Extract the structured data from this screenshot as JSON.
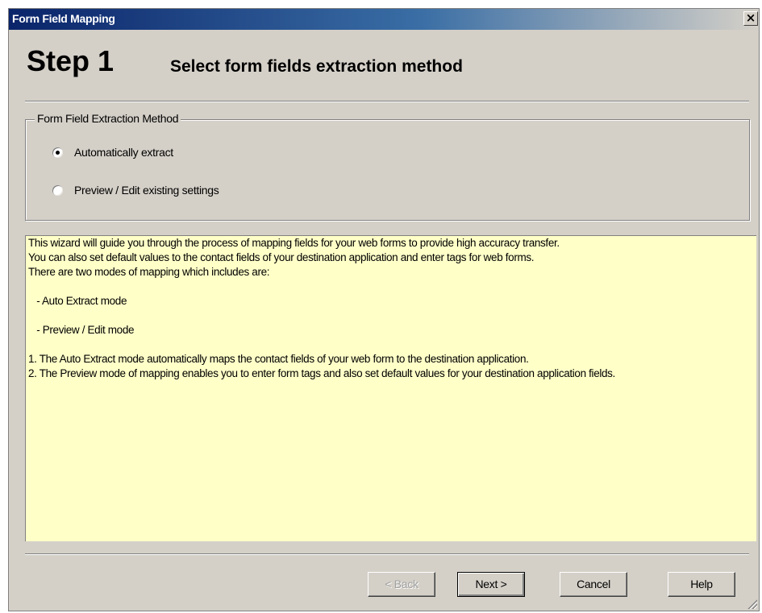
{
  "window": {
    "title": "Form Field Mapping",
    "close_glyph": "×",
    "close_icon": "close-icon"
  },
  "header": {
    "step": "Step 1",
    "subtitle": "Select form fields extraction method"
  },
  "extraction_group": {
    "legend": "Form Field Extraction Method",
    "options": [
      {
        "label": "Automatically extract",
        "selected": true
      },
      {
        "label": "Preview / Edit existing settings",
        "selected": false
      }
    ]
  },
  "info_panel": {
    "background": "#ffffc8",
    "lines": [
      "This wizard will guide you through the process of mapping fields for your web forms to provide high accuracy transfer.",
      "You can also set default values to the contact fields of your destination application and enter tags for web forms.",
      "There are two modes of mapping which includes are:",
      "   - Auto Extract mode",
      "   - Preview / Edit mode",
      "1. The Auto Extract mode automatically maps the contact fields of your web form to the destination application.",
      "2. The Preview mode of mapping enables you to enter form tags and also set default values for your destination application fields."
    ]
  },
  "buttons": {
    "back": {
      "label": "< Back",
      "enabled": false
    },
    "next": {
      "label": "Next >",
      "enabled": true
    },
    "cancel": {
      "label": "Cancel",
      "enabled": true
    },
    "help": {
      "label": "Help",
      "enabled": true
    }
  },
  "colors": {
    "dialog_face": "#d4d0c8",
    "titlebar_start": "#0a246a",
    "titlebar_end": "#3a6ea5",
    "info_background": "#ffffc8"
  }
}
